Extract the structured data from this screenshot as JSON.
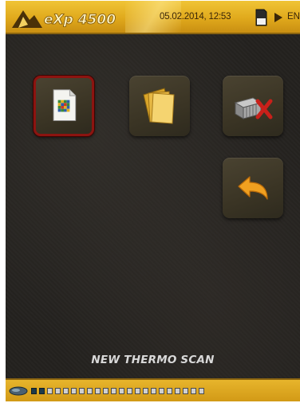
{
  "header": {
    "brand": "eXp 4500",
    "datetime": "05.02.2014, 12:53",
    "language": "EN"
  },
  "tiles": [
    {
      "id": "new-thermo-scan",
      "icon": "scan-document-icon",
      "selected": true
    },
    {
      "id": "open-files",
      "icon": "files-icon",
      "selected": false
    },
    {
      "id": "delete",
      "icon": "delete-icon",
      "selected": false
    },
    {
      "id": "back",
      "icon": "back-arrow-icon",
      "selected": false
    }
  ],
  "status_label": "NEW THERMO SCAN",
  "footer": {
    "battery_icon": "battery-icon",
    "segments_total": 22,
    "segments_filled": 2
  },
  "colors": {
    "header_gold": "#e0a91c",
    "selection_red": "#8c1410",
    "background": "#24221f"
  }
}
